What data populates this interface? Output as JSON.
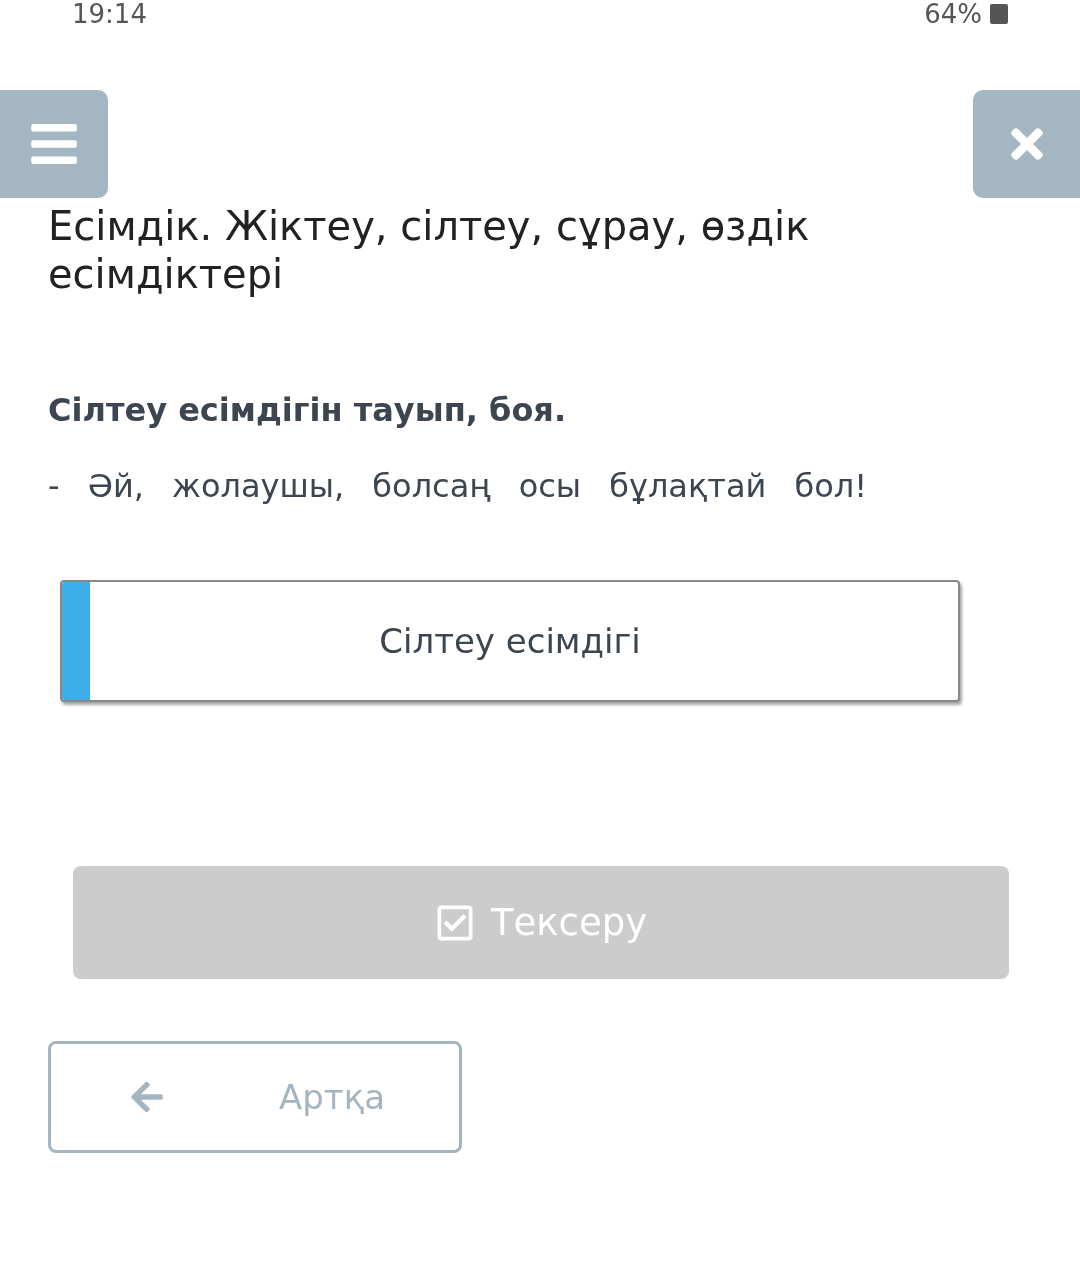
{
  "status_bar": {
    "time": "19:14",
    "battery": "64%"
  },
  "title": "Есімдік. Жіктеу, сілтеу, сұрау, өздік есімдіктері",
  "instruction": "Сілтеу есімдігін тауып, боя.",
  "sentence": "- Әй, жолаушы, болсаң осы бұлақтай бол!",
  "options": [
    {
      "label": "Сілтеу есімдігі",
      "selected": true
    }
  ],
  "check_button": {
    "label": "Тексеру",
    "disabled": true
  },
  "back_button": {
    "label": "Артқа"
  }
}
